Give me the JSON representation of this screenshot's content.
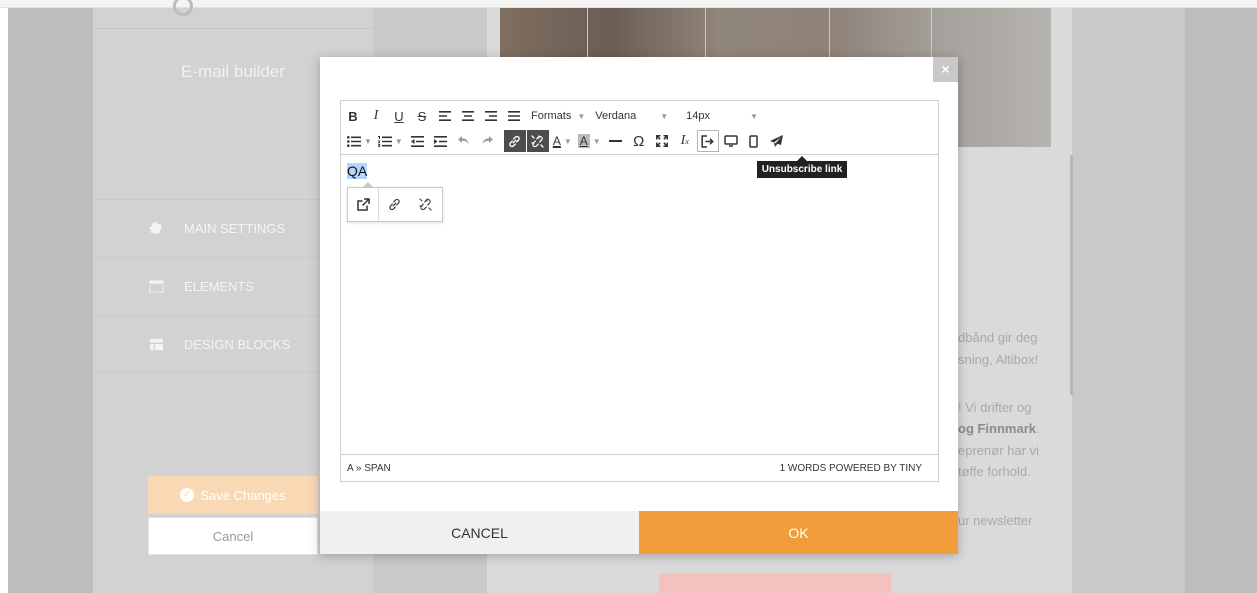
{
  "sidebar": {
    "title": "E-mail builder",
    "items": [
      {
        "label": "MAIN SETTINGS",
        "icon": "gear-icon"
      },
      {
        "label": "ELEMENTS",
        "icon": "elements-icon"
      },
      {
        "label": "DESIGN BLOCKS",
        "icon": "blocks-icon"
      }
    ],
    "save_label": "Save Changes",
    "cancel_label": "Cancel"
  },
  "background_text": {
    "line1": "dbånd gir deg",
    "line2": "sning, Altibox!",
    "line3": "! Vi drifter og",
    "line4_bold": "og Finnmark",
    "line4_end": ".",
    "line5": "eprenør har vi",
    "line6": "tøffe forhold.",
    "line7": "ur newsletter"
  },
  "editor": {
    "toolbar": {
      "formats_label": "Formats",
      "font_family": "Verdana",
      "font_size": "14px"
    },
    "tooltip": "Unsubscribe link",
    "content_text": "QA",
    "status_path": "A » SPAN",
    "status_right": "1 WORDS POWERED BY TINY"
  },
  "modal": {
    "close_label": "×",
    "cancel_label": "CANCEL",
    "ok_label": "OK"
  },
  "colors": {
    "accent_orange": "#f39c3b",
    "save_disabled": "#f8d9b3",
    "cta_pink": "#f4c1bd"
  }
}
